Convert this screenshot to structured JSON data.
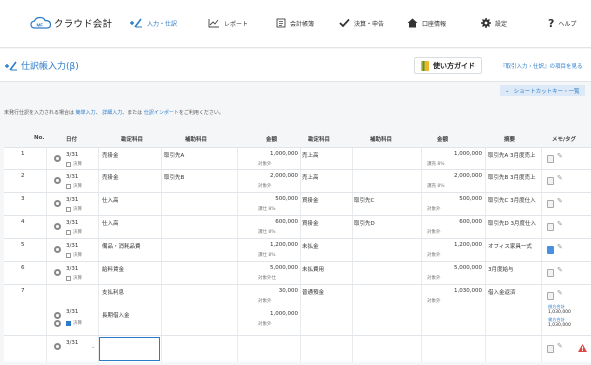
{
  "app": {
    "logo_text": "クラウド会計",
    "logo_mark": "MF"
  },
  "nav": [
    {
      "label": "入力・仕訳",
      "active": true
    },
    {
      "label": "レポート"
    },
    {
      "label": "会計帳簿"
    },
    {
      "label": "決算・申告"
    },
    {
      "label": "口座情報"
    },
    {
      "label": "設定"
    },
    {
      "label": "ヘルプ"
    }
  ],
  "page": {
    "title": "仕訳帳入力(β)"
  },
  "guide": {
    "button": "使い方ガイド",
    "link": "『取引入力・仕訳』の項目を見る"
  },
  "shortcut": {
    "label": "ショートカットキー・一覧"
  },
  "notice": {
    "prefix": "未発行仕訳を入力される場合は",
    "link1": "簡単入力",
    "sep1": "、",
    "link2": "詳細入力",
    "sep2": "、または",
    "link3": "仕訳インポート",
    "suffix": "をご利用ください。"
  },
  "headers": {
    "no": "No.",
    "date": "日付",
    "debit_account": "勘定科目",
    "debit_sub": "補助科目",
    "debit_amount": "金額",
    "credit_account": "勘定科目",
    "credit_sub": "補助科目",
    "credit_amount": "金額",
    "summary": "摘要",
    "memo": "メモ/タグ"
  },
  "closing_label": "決算",
  "rows": [
    {
      "no": "1",
      "date": "3/31",
      "d_acc": "売掛金",
      "d_sub": "取引先A",
      "d_amt": "1,000,000",
      "d_tax": "対象外",
      "c_acc": "売上高",
      "c_sub": "",
      "c_amt": "1,000,000",
      "c_tax": "課売 8%",
      "summary": "取引先A 3月度売上"
    },
    {
      "no": "2",
      "date": "3/31",
      "d_acc": "売掛金",
      "d_sub": "取引先B",
      "d_amt": "2,000,000",
      "d_tax": "対象外",
      "c_acc": "売上高",
      "c_sub": "",
      "c_amt": "2,000,000",
      "c_tax": "課売 8%",
      "summary": "取引先B 3月度売上"
    },
    {
      "no": "3",
      "date": "3/31",
      "d_acc": "仕入高",
      "d_sub": "",
      "d_amt": "500,000",
      "d_tax": "課仕 8%",
      "c_acc": "買掛金",
      "c_sub": "取引先C",
      "c_amt": "500,000",
      "c_tax": "対象外",
      "summary": "取引先C 3月度仕入"
    },
    {
      "no": "4",
      "date": "3/31",
      "d_acc": "仕入高",
      "d_sub": "",
      "d_amt": "600,000",
      "d_tax": "課仕 8%",
      "c_acc": "買掛金",
      "c_sub": "取引先D",
      "c_amt": "600,000",
      "c_tax": "対象外",
      "summary": "取引先D 3月度仕入"
    },
    {
      "no": "5",
      "date": "3/31",
      "d_acc": "備品・消耗品費",
      "d_sub": "",
      "d_amt": "1,200,000",
      "d_tax": "課仕 8%",
      "c_acc": "未払金",
      "c_sub": "",
      "c_amt": "1,200,000",
      "c_tax": "対象外",
      "summary": "オフィス家具一式"
    },
    {
      "no": "6",
      "date": "3/31",
      "d_acc": "給料賃金",
      "d_sub": "",
      "d_amt": "5,000,000",
      "d_tax": "対象外仕",
      "c_acc": "未払費用",
      "c_sub": "",
      "c_amt": "5,000,000",
      "c_tax": "対象外",
      "summary": "3月度給与"
    },
    {
      "no": "7",
      "date": "3/31",
      "d_acc": "支払利息",
      "d_sub": "",
      "d_amt": "30,000",
      "d_tax": "対象外",
      "c_acc": "普通預金",
      "c_sub": "",
      "c_amt": "1,030,000",
      "c_tax": "対象外",
      "summary": "借入金返済",
      "d2_acc": "長期借入金",
      "d2_amt": "1,000,000",
      "d2_tax": "対象外",
      "debit_total_label": "借方合計",
      "debit_total": "1,030,000",
      "credit_total_label": "貸方合計",
      "credit_total": "1,030,000"
    },
    {
      "no": "",
      "date": "3/31"
    }
  ]
}
